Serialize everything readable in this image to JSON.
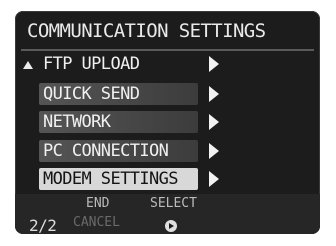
{
  "screen": {
    "title": "COMMUNICATION SETTINGS",
    "page_indicator": "2/2"
  },
  "menu": {
    "items": [
      {
        "label": "FTP UPLOAD",
        "selected": false
      },
      {
        "label": "QUICK SEND",
        "selected": false
      },
      {
        "label": "NETWORK",
        "selected": false
      },
      {
        "label": "PC CONNECTION",
        "selected": false
      },
      {
        "label": "MODEM SETTINGS",
        "selected": true
      }
    ]
  },
  "footer": {
    "end_label": "END",
    "cancel_label": "CANCEL",
    "select_label": "SELECT"
  },
  "icons": {
    "scroll_up": "triangle-up-icon",
    "submenu": "chevron-right-icon",
    "ok_button": "ok-button-icon"
  },
  "colors": {
    "screen_bg": "#1c1c1c",
    "highlight": "#d8d8d8",
    "text": "#f0f0f0",
    "footer_text": "#bbbbbb",
    "disabled_text": "#6a6a6a"
  }
}
